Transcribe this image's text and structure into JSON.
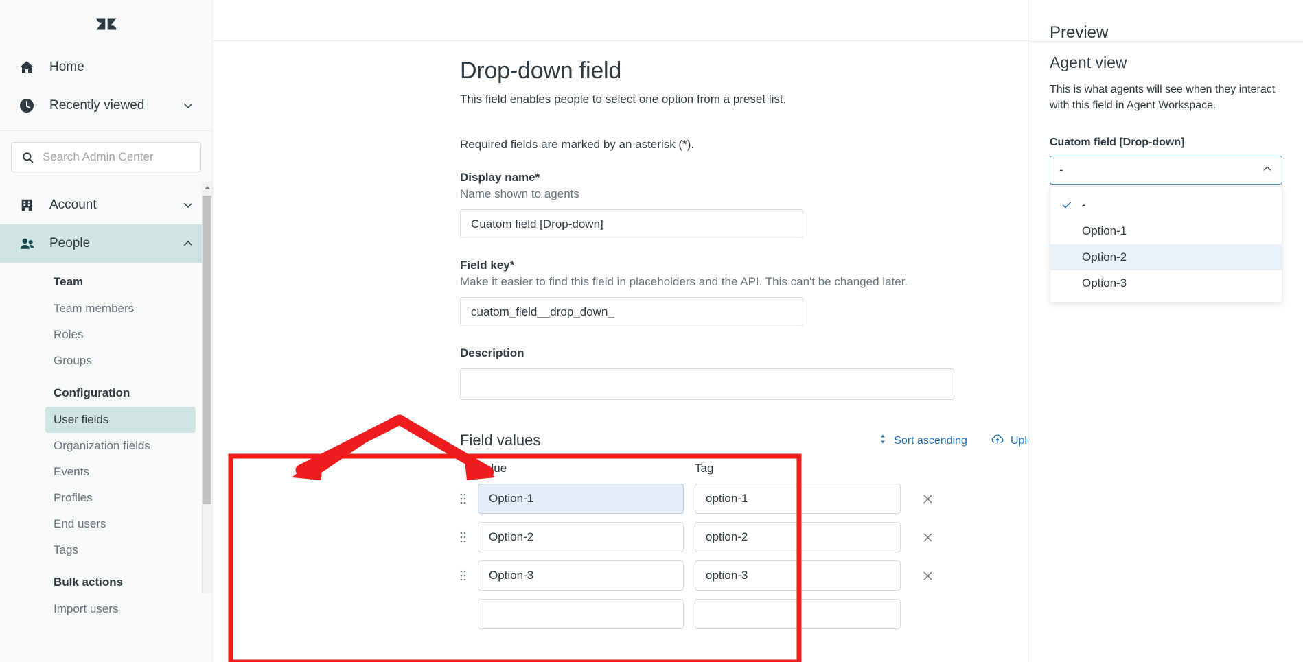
{
  "sidebar": {
    "logo": "zendesk-logo",
    "top_items": [
      {
        "label": "Home",
        "icon": "home-icon",
        "chevron": false
      },
      {
        "label": "Recently viewed",
        "icon": "clock-icon",
        "chevron": true
      }
    ],
    "search": {
      "placeholder": "Search Admin Center",
      "icon": "search-icon"
    },
    "sections": [
      {
        "label": "Account",
        "icon": "building-icon",
        "expanded": false
      },
      {
        "label": "People",
        "icon": "people-icon",
        "expanded": true
      }
    ],
    "groups": [
      {
        "title": "Team",
        "items": [
          "Team members",
          "Roles",
          "Groups"
        ]
      },
      {
        "title": "Configuration",
        "items": [
          "User fields",
          "Organization fields",
          "Events",
          "Profiles",
          "End users",
          "Tags"
        ]
      },
      {
        "title": "Bulk actions",
        "items": [
          "Import users"
        ]
      }
    ],
    "selected_item": "User fields"
  },
  "topbar": {
    "icons": [
      {
        "name": "apps-grid-icon",
        "glyph": "grid"
      },
      {
        "name": "help-icon",
        "glyph": "question"
      },
      {
        "name": "user-avatar-icon",
        "glyph": "person"
      }
    ]
  },
  "main": {
    "title": "Drop-down field",
    "subtitle": "This field enables people to select one option from a preset list.",
    "required_note": "Required fields are marked by an asterisk (*).",
    "display_name": {
      "label": "Display name*",
      "hint": "Name shown to agents",
      "value": "Cuatom field [Drop-down]"
    },
    "field_key": {
      "label": "Field key*",
      "hint": "Make it easier to find this field in placeholders and the API. This can't be changed later.",
      "value": "cuatom_field__drop_down_"
    },
    "description": {
      "label": "Description",
      "value": ""
    },
    "field_values": {
      "title": "Field values",
      "sort_label": "Sort ascending",
      "sort_icon": "sort-ascending-icon",
      "upload_label": "Upload CSV",
      "upload_icon": "cloud-upload-icon",
      "columns": [
        "Value",
        "Tag"
      ],
      "rows": [
        {
          "value": "Option-1",
          "tag": "option-1",
          "focused": true
        },
        {
          "value": "Option-2",
          "tag": "option-2",
          "focused": false
        },
        {
          "value": "Option-3",
          "tag": "option-3",
          "focused": false
        },
        {
          "value": "",
          "tag": "",
          "focused": false,
          "no_delete": true
        }
      ],
      "delete_icon": "close-x-icon",
      "drag_icon": "drag-handle-icon"
    }
  },
  "preview": {
    "clipped_title": "Preview",
    "heading": "Agent view",
    "paragraph": "This is what agents will see when they interact with this field in Agent Workspace.",
    "field_label": "Cuatom field [Drop-down]",
    "selected_value": "-",
    "chevron_icon": "chevron-up-icon",
    "options": [
      {
        "label": "-",
        "checked": true,
        "hovered": false
      },
      {
        "label": "Option-1",
        "checked": false,
        "hovered": false
      },
      {
        "label": "Option-2",
        "checked": false,
        "hovered": true
      },
      {
        "label": "Option-3",
        "checked": false,
        "hovered": false
      }
    ],
    "check_icon": "check-icon"
  },
  "annotations": {
    "highlight_color": "#ee1c1c",
    "box_label": "field-values-highlight-box",
    "arrows_label": "value-tag-columns-arrows"
  }
}
